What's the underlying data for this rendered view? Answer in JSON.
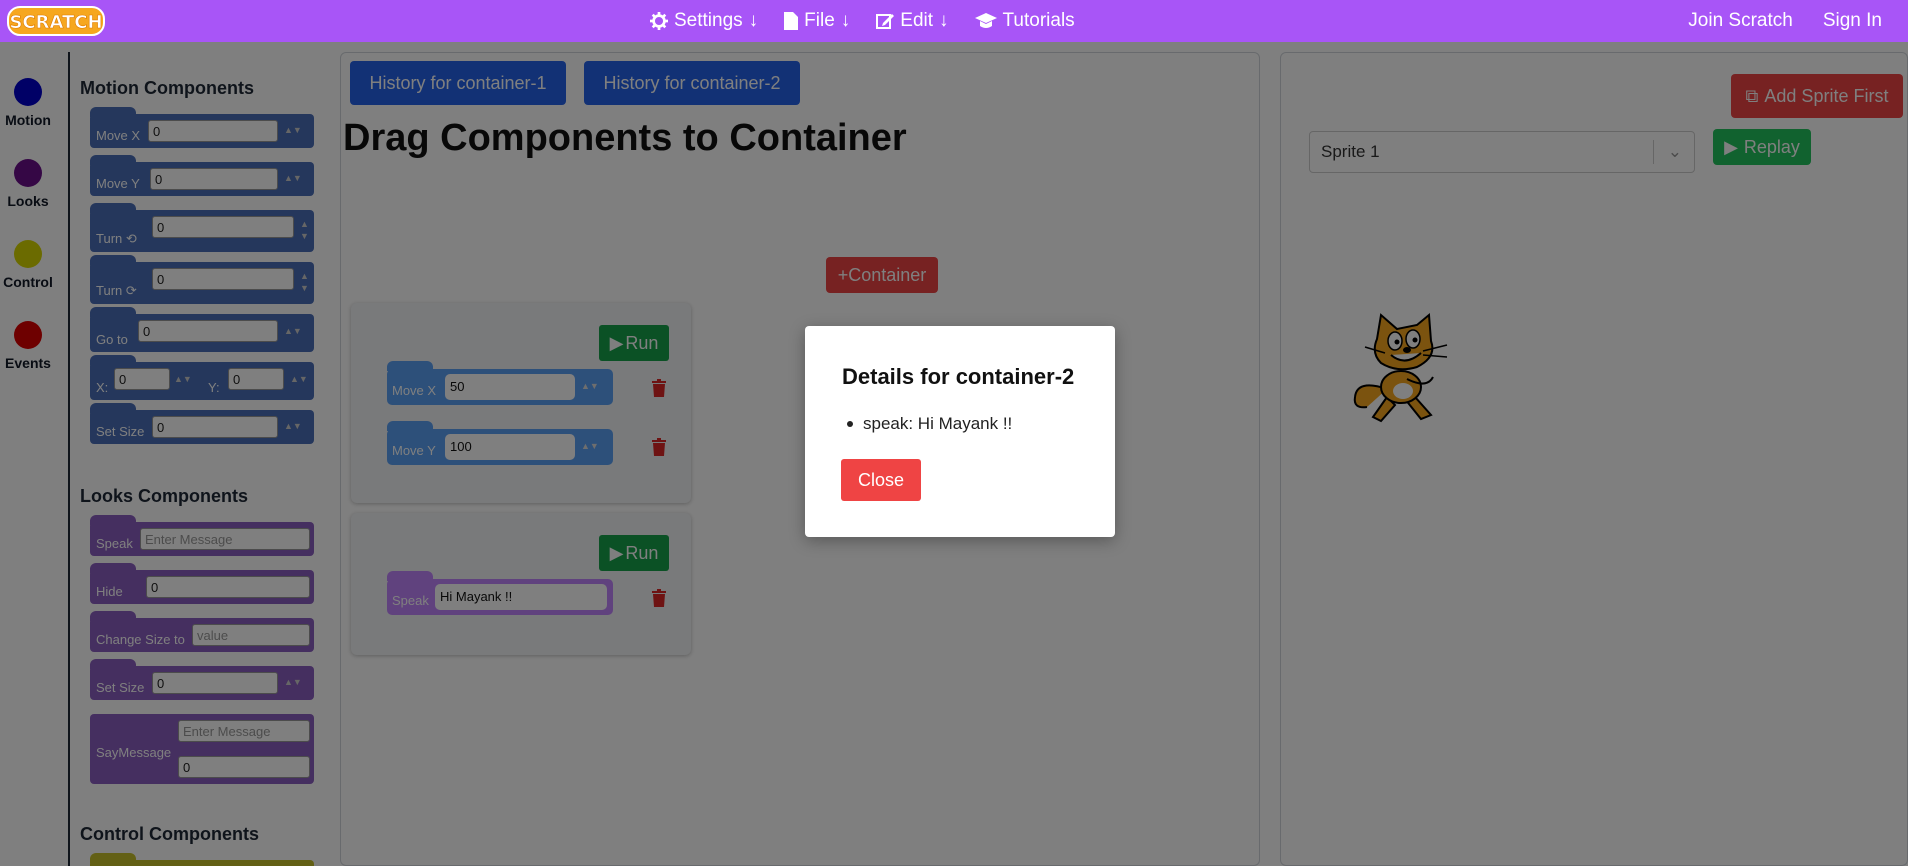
{
  "nav": {
    "logo_text": "SCRATCH",
    "items": [
      {
        "label": "Settings",
        "icon": "gear-icon"
      },
      {
        "label": "File",
        "icon": "file-icon"
      },
      {
        "label": "Edit",
        "icon": "edit-icon"
      },
      {
        "label": "Tutorials",
        "icon": "graduation-cap-icon"
      }
    ],
    "join": "Join Scratch",
    "signin": "Sign In",
    "color": "#a855f7"
  },
  "categories": [
    {
      "label": "Motion",
      "color": "#0000cc"
    },
    {
      "label": "Looks",
      "color": "#6b0f8a"
    },
    {
      "label": "Control",
      "color": "#d6d600"
    },
    {
      "label": "Events",
      "color": "#dd0000"
    }
  ],
  "palette": {
    "motion_title": "Motion Components",
    "looks_title": "Looks Components",
    "control_title": "Control Components",
    "motion": {
      "move_x": {
        "label": "Move X",
        "value": "0"
      },
      "move_y": {
        "label": "Move Y",
        "value": "0"
      },
      "turn_ccw": {
        "label": "Turn",
        "value": "0"
      },
      "turn_cw": {
        "label": "Turn",
        "value": "0"
      },
      "go_to": {
        "label": "Go to",
        "value": "0"
      },
      "xy": {
        "x_label": "X:",
        "x_value": "0",
        "y_label": "Y:",
        "y_value": "0"
      },
      "set_size": {
        "label": "Set Size",
        "value": "0"
      }
    },
    "looks": {
      "speak": {
        "label": "Speak",
        "placeholder": "Enter Message"
      },
      "hide": {
        "label": "Hide",
        "value": "0"
      },
      "change_size": {
        "label": "Change Size to",
        "placeholder": "value"
      },
      "set_size": {
        "label": "Set Size",
        "value": "0"
      },
      "say_message": {
        "label": "SayMessage",
        "placeholder": "Enter Message",
        "value": "0"
      }
    }
  },
  "main": {
    "history_1": "History for container-1",
    "history_2": "History for container-2",
    "title": "Drag Components to Container",
    "add_container": "+Container",
    "run_label": "Run",
    "container1": {
      "blocks": [
        {
          "label": "Move X",
          "value": "50"
        },
        {
          "label": "Move Y",
          "value": "100"
        }
      ]
    },
    "container2": {
      "blocks": [
        {
          "label": "Speak",
          "value": "Hi Mayank !!"
        }
      ]
    }
  },
  "stage": {
    "add_sprite": "Add Sprite First",
    "sprite_selected": "Sprite 1",
    "replay": "Replay"
  },
  "modal": {
    "title": "Details for container-2",
    "items": [
      "speak: Hi Mayank !!"
    ],
    "close": "Close"
  }
}
